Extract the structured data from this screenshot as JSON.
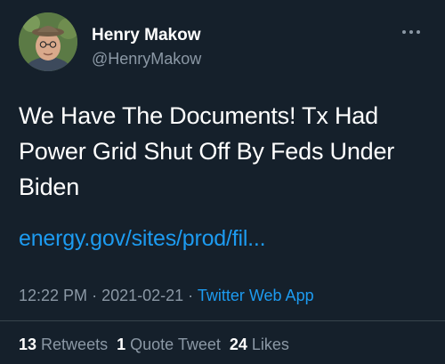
{
  "user": {
    "display_name": "Henry Makow",
    "handle": "@HenryMakow",
    "avatar_icon": "user-avatar-photo"
  },
  "tweet": {
    "text_lines": [
      "We Have The Documents! Tx Had",
      "Power Grid Shut Off By Feds Under",
      "Biden"
    ],
    "link": "energy.gov/sites/prod/fil...",
    "time": "12:22 PM",
    "separator": "·",
    "date": "2021-02-21",
    "source": "Twitter Web App"
  },
  "stats": {
    "retweets_count": "13",
    "retweets_label": "Retweets",
    "quotes_count": "1",
    "quotes_label": "Quote Tweet",
    "likes_count": "24",
    "likes_label": "Likes"
  },
  "colors": {
    "background": "#15202b",
    "accent": "#1d9bf0",
    "secondary_text": "#8b98a5",
    "divider": "#38444d"
  }
}
